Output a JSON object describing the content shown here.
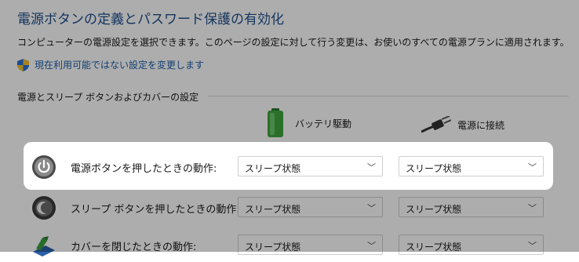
{
  "page": {
    "title": "電源ボタンの定義とパスワード保護の有効化",
    "description": "コンピューターの電源設定を選択できます。このページの設定に対して行う変更は、お使いのすべての電源プランに適用されます。",
    "admin_link": "現在利用可能ではない設定を変更します"
  },
  "group": {
    "title": "電源とスリープ ボタンおよびカバーの設定",
    "columns": {
      "battery": "バッテリ駆動",
      "plugged": "電源に接続"
    },
    "rows": [
      {
        "icon": "power-button-icon",
        "label": "電源ボタンを押したときの動作:",
        "battery_value": "スリープ状態",
        "plugged_value": "スリープ状態"
      },
      {
        "icon": "sleep-button-icon",
        "label": "スリープ ボタンを押したときの動作:",
        "battery_value": "スリープ状態",
        "plugged_value": "スリープ状態"
      },
      {
        "icon": "lid-close-icon",
        "label": "カバーを閉じたときの動作:",
        "battery_value": "スリープ状態",
        "plugged_value": "スリープ状態"
      }
    ]
  },
  "dropdown_chevron": "﹀",
  "colors": {
    "title": "#1f4e8c",
    "link": "#1f5fa8",
    "dim_overlay": "rgba(0,0,0,0.32)"
  }
}
